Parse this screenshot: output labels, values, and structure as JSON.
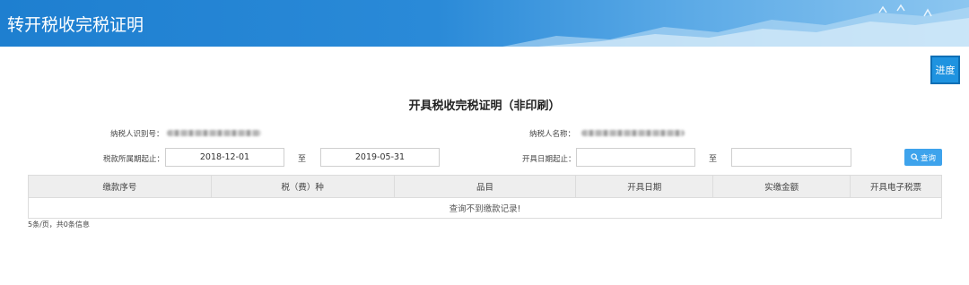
{
  "header": {
    "title": "转开税收完税证明"
  },
  "toolbar": {
    "progress_label": "进度"
  },
  "main": {
    "heading": "开具税收完税证明（非印刷）",
    "form": {
      "taxpayer_id_label": "纳税人识别号：",
      "taxpayer_name_label": "纳税人名称：",
      "tax_period_label": "税款所属期起止：",
      "tax_period_start": "2018-12-01",
      "tax_period_sep": "至",
      "tax_period_end": "2019-05-31",
      "issue_date_label": "开具日期起止：",
      "issue_date_start": "",
      "issue_date_sep": "至",
      "issue_date_end": "",
      "query_label": "查询"
    },
    "table": {
      "columns": [
        "缴款序号",
        "税（费）种",
        "品目",
        "开具日期",
        "实缴金额",
        "开具电子税票"
      ],
      "empty_message": "查询不到缴款记录!"
    },
    "pagination": {
      "text": "5条/页，共0条信息"
    }
  },
  "colors": {
    "header_blue": "#1e7fd0",
    "button_blue": "#1f93e0",
    "query_blue": "#3ea3ec"
  },
  "icons": {
    "query": "search-icon"
  }
}
